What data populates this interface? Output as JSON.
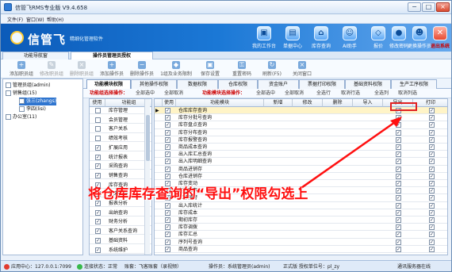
{
  "window": {
    "title": "信管飞RMS专业版 V9.4.658",
    "menus": [
      "文件(F)",
      "窗口(W)",
      "帮助(H)"
    ]
  },
  "banner": {
    "brand": "信管飞",
    "slogan": "精细化管理软件",
    "buttons": [
      "我的工作台",
      "单据中心",
      "库存查询",
      "AI助手",
      "报价",
      "修改密码",
      "更换操作员",
      "退出系统"
    ]
  },
  "main_tabs": [
    "功能导航窗",
    "操作员管理员授权"
  ],
  "toolbar": [
    "添加职员组",
    "修改职员组",
    "删除职员组",
    "添加操作员",
    "删除操作员",
    "1组及业务限制",
    "保存设置",
    "重置密码",
    "刷新(F5)",
    "关闭窗口"
  ],
  "tree": [
    {
      "label": "管理员组(admin)",
      "level": 0,
      "checked": true,
      "selected": false
    },
    {
      "label": "销售组(15)",
      "level": 0,
      "checked": true,
      "selected": false
    },
    {
      "label": "张三(zhangs)",
      "level": 1,
      "checked": true,
      "selected": true
    },
    {
      "label": "李四(lisi)",
      "level": 1,
      "checked": true,
      "selected": false
    },
    {
      "label": "办公室(11)",
      "level": 0,
      "checked": false,
      "selected": false
    }
  ],
  "sub_tabs": [
    "功能模块权限",
    "其他操作权限",
    "数据权限",
    "仓库权限",
    "资金账户",
    "票据打印权限",
    "基础资料权限",
    "生产工序权限"
  ],
  "ops": {
    "left_title": "功能组选择操作：",
    "left_items": [
      "全部选中",
      "全部取消"
    ],
    "right_title": "功能模块选择操作：",
    "right_items": [
      "全部选中",
      "全部取消",
      "全选行",
      "取消行选",
      "全选列",
      "取消列选"
    ]
  },
  "left_grid": {
    "headers": [
      "使用",
      "功能组"
    ],
    "rows": [
      {
        "label": "库存管理",
        "checked": false
      },
      {
        "label": "会员管理",
        "checked": false
      },
      {
        "label": "客户关系",
        "checked": false
      },
      {
        "label": "绩效考核",
        "checked": false
      },
      {
        "label": "扩展应用",
        "checked": true
      },
      {
        "label": "统计报表",
        "checked": true
      },
      {
        "label": "采购查询",
        "checked": true
      },
      {
        "label": "销售查询",
        "checked": true
      },
      {
        "label": "库存查询",
        "checked": true
      },
      {
        "label": "往来查询",
        "checked": true
      },
      {
        "label": "报表分析",
        "checked": true
      },
      {
        "label": "出纳查询",
        "checked": true
      },
      {
        "label": "财务分析",
        "checked": true
      },
      {
        "label": "客户关系查询",
        "checked": true
      },
      {
        "label": "基础资料",
        "checked": true
      },
      {
        "label": "系统维护",
        "checked": true
      }
    ]
  },
  "right_grid": {
    "headers": [
      "使用",
      "功能模块",
      "新增",
      "修改",
      "删除",
      "导入",
      "导出",
      "打印"
    ],
    "rows": [
      {
        "label": "仓库库存查询",
        "selected": true,
        "use": true,
        "export": true,
        "print": true
      },
      {
        "label": "库存分批号查询",
        "selected": false,
        "use": true,
        "export": true,
        "print": true
      },
      {
        "label": "库存盘点查询",
        "selected": false,
        "use": true,
        "export": true,
        "print": true
      },
      {
        "label": "库存分布查询",
        "selected": false,
        "use": true,
        "export": true,
        "print": true
      },
      {
        "label": "库存报警查询",
        "selected": false,
        "use": true,
        "export": true,
        "print": true
      },
      {
        "label": "商品成本查询",
        "selected": false,
        "use": true,
        "export": true,
        "print": true
      },
      {
        "label": "出入库汇总查询",
        "selected": false,
        "use": true,
        "export": true,
        "print": true
      },
      {
        "label": "出入库明细查询",
        "selected": false,
        "use": true,
        "export": true,
        "print": true
      },
      {
        "label": "商品进销存",
        "selected": false,
        "use": true,
        "export": true,
        "print": true
      },
      {
        "label": "仓库进销存",
        "selected": false,
        "use": true,
        "export": true,
        "print": true
      },
      {
        "label": "库存变动",
        "selected": false,
        "use": true,
        "export": true,
        "print": true
      },
      {
        "label": "在途库存",
        "selected": false,
        "use": true,
        "export": true,
        "print": true
      },
      {
        "label": "库存预警",
        "selected": false,
        "use": true,
        "export": true,
        "print": true
      },
      {
        "label": "出入库统计",
        "selected": false,
        "use": true,
        "export": true,
        "print": true
      },
      {
        "label": "库存成本",
        "selected": false,
        "use": true,
        "export": true,
        "print": true
      },
      {
        "label": "期初库存",
        "selected": false,
        "use": true,
        "export": true,
        "print": true
      },
      {
        "label": "库存调拨",
        "selected": false,
        "use": true,
        "export": true,
        "print": true
      },
      {
        "label": "库存汇总",
        "selected": false,
        "use": true,
        "export": true,
        "print": true
      },
      {
        "label": "序列号查询",
        "selected": false,
        "use": true,
        "export": true,
        "print": true
      },
      {
        "label": "商品查询",
        "selected": false,
        "use": true,
        "export": true,
        "print": true
      }
    ]
  },
  "annotation": "将仓库库存查询的“导出”权限勾选上",
  "status": [
    "应用中心：127.0.0.1:7099",
    "连接状态：正常",
    "账套：飞客账套（录视频）",
    "操作员：系统管理员(admin)",
    "正式版 授权单位号：pl_zy",
    "通讯服务器在线"
  ]
}
